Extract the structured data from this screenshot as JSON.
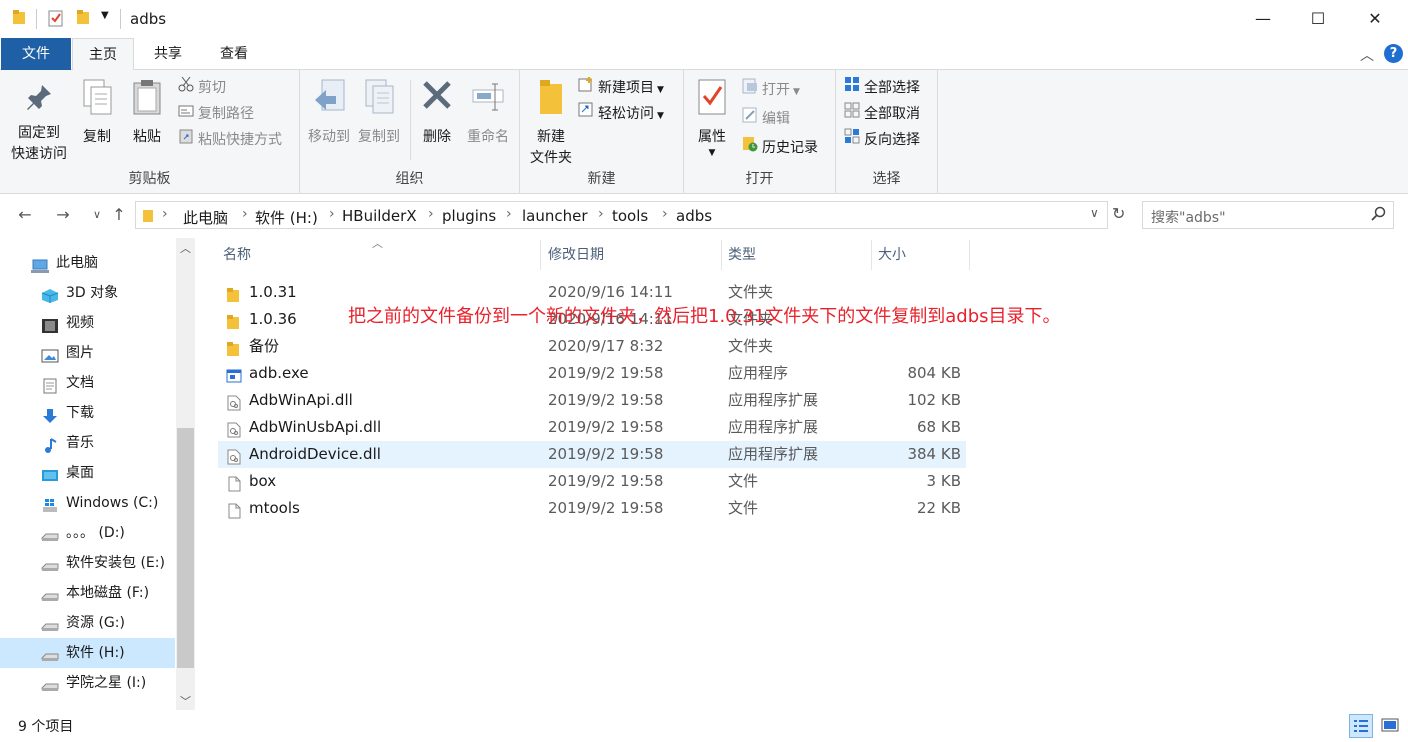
{
  "window": {
    "title": "adbs",
    "controls": {
      "minimize": "—",
      "maximize": "☐",
      "close": "✕"
    }
  },
  "tabs": {
    "file": "文件",
    "home": "主页",
    "share": "共享",
    "view": "查看"
  },
  "ribbon": {
    "clipboard": {
      "label": "剪贴板",
      "pin_line1": "固定到",
      "pin_line2": "快速访问",
      "copy": "复制",
      "paste": "粘贴",
      "cut": "剪切",
      "copy_path": "复制路径",
      "paste_shortcut": "粘贴快捷方式"
    },
    "organize": {
      "label": "组织",
      "move_to": "移动到",
      "copy_to": "复制到",
      "delete": "删除",
      "rename": "重命名"
    },
    "new": {
      "label": "新建",
      "new_folder_line1": "新建",
      "new_folder_line2": "文件夹",
      "new_item": "新建项目",
      "easy_access": "轻松访问"
    },
    "open": {
      "label": "打开",
      "properties": "属性",
      "open": "打开",
      "edit": "编辑",
      "history": "历史记录"
    },
    "select": {
      "label": "选择",
      "select_all": "全部选择",
      "select_none": "全部取消",
      "invert": "反向选择"
    }
  },
  "address": {
    "crumbs": [
      "此电脑",
      "软件 (H:)",
      "HBuilderX",
      "plugins",
      "launcher",
      "tools",
      "adbs"
    ],
    "search_placeholder": "搜索\"adbs\""
  },
  "sidebar": {
    "items": [
      {
        "label": "此电脑",
        "icon": "computer-icon"
      },
      {
        "label": "3D 对象",
        "icon": "cube-icon"
      },
      {
        "label": "视频",
        "icon": "video-icon"
      },
      {
        "label": "图片",
        "icon": "picture-icon"
      },
      {
        "label": "文档",
        "icon": "document-icon"
      },
      {
        "label": "下载",
        "icon": "download-icon"
      },
      {
        "label": "音乐",
        "icon": "music-icon"
      },
      {
        "label": "桌面",
        "icon": "desktop-icon"
      },
      {
        "label": "Windows (C:)",
        "icon": "windows-drive-icon"
      },
      {
        "label": "。。。 (D:)",
        "icon": "drive-icon"
      },
      {
        "label": "软件安装包 (E:)",
        "icon": "drive-icon"
      },
      {
        "label": "本地磁盘 (F:)",
        "icon": "drive-icon"
      },
      {
        "label": "资源 (G:)",
        "icon": "drive-icon"
      },
      {
        "label": "软件 (H:)",
        "icon": "drive-icon"
      },
      {
        "label": "学院之星 (I:)",
        "icon": "drive-icon"
      }
    ],
    "selected_index": 13
  },
  "filelist": {
    "columns": {
      "name": "名称",
      "date": "修改日期",
      "type": "类型",
      "size": "大小"
    },
    "rows": [
      {
        "name": "1.0.31",
        "date": "2020/9/16 14:11",
        "type": "文件夹",
        "size": "",
        "icon": "folder-icon"
      },
      {
        "name": "1.0.36",
        "date": "2020/9/16 14:11",
        "type": "文件夹",
        "size": "",
        "icon": "folder-icon"
      },
      {
        "name": "备份",
        "date": "2020/9/17 8:32",
        "type": "文件夹",
        "size": "",
        "icon": "folder-icon"
      },
      {
        "name": "adb.exe",
        "date": "2019/9/2 19:58",
        "type": "应用程序",
        "size": "804 KB",
        "icon": "exe-icon"
      },
      {
        "name": "AdbWinApi.dll",
        "date": "2019/9/2 19:58",
        "type": "应用程序扩展",
        "size": "102 KB",
        "icon": "dll-icon"
      },
      {
        "name": "AdbWinUsbApi.dll",
        "date": "2019/9/2 19:58",
        "type": "应用程序扩展",
        "size": "68 KB",
        "icon": "dll-icon"
      },
      {
        "name": "AndroidDevice.dll",
        "date": "2019/9/2 19:58",
        "type": "应用程序扩展",
        "size": "384 KB",
        "icon": "dll-icon"
      },
      {
        "name": "box",
        "date": "2019/9/2 19:58",
        "type": "文件",
        "size": "3 KB",
        "icon": "file-icon"
      },
      {
        "name": "mtools",
        "date": "2019/9/2 19:58",
        "type": "文件",
        "size": "22 KB",
        "icon": "file-icon"
      }
    ],
    "highlighted_index": 6
  },
  "annotation": "把之前的文件备份到一个新的文件夹，然后把1.0.31文件夹下的文件复制到adbs目录下。",
  "status": {
    "item_count": "9 个项目"
  },
  "colors": {
    "file_tab": "#1f5fa6",
    "selection": "#cce8ff",
    "hover_row": "#e5f3ff",
    "annotation": "#e8222c",
    "folder": "#f3c13a"
  }
}
